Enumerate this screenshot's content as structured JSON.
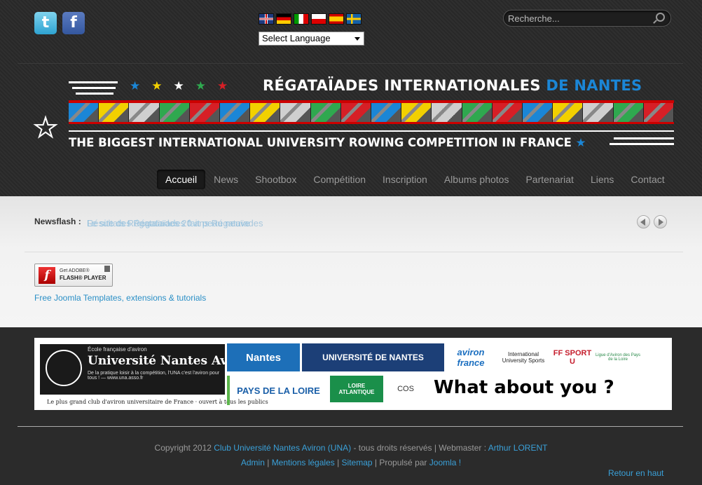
{
  "header": {
    "social": [
      {
        "name": "twitter",
        "glyph": "t"
      },
      {
        "name": "facebook",
        "glyph": "f"
      }
    ],
    "flags": [
      "en",
      "de",
      "it",
      "pl",
      "es",
      "sv"
    ],
    "language_select": "Select Language",
    "search_placeholder": "Recherche..."
  },
  "banner": {
    "title_main": "RÉGATAÏADES INTERNATIONALES",
    "title_accent": "DE NANTES",
    "subtitle": "THE BIGGEST INTERNATIONAL UNIVERSITY ROWING COMPETITION IN FRANCE",
    "star_colors": [
      "#1b86d6",
      "#f2d000",
      "#ffffff",
      "#2fa84f",
      "#d61f26"
    ],
    "strip_colors": [
      "#1b86d6",
      "#f2d000",
      "#cfcfcf",
      "#2fa84f",
      "#d61f26",
      "#1b86d6",
      "#f2d000",
      "#cfcfcf",
      "#2fa84f",
      "#d61f26",
      "#1b86d6",
      "#f2d000",
      "#cfcfcf",
      "#2fa84f",
      "#d61f26",
      "#1b86d6",
      "#f2d000",
      "#cfcfcf",
      "#2fa84f",
      "#d61f26"
    ],
    "accent_color": "#1b86d6"
  },
  "nav": {
    "items": [
      "Accueil",
      "News",
      "Shootbox",
      "Compétition",
      "Inscription",
      "Albums photos",
      "Partenariat",
      "Liens",
      "Contact"
    ],
    "active": "Accueil"
  },
  "newsflash": {
    "label": "Newsflash :",
    "text_a": "Le site des Régataïades fait peau neuve",
    "text_b": "Résultats Régataïades 20 ans Régataïades"
  },
  "content": {
    "flash_badge": {
      "line1": "Get ADOBE®",
      "line2": "FLASH® PLAYER"
    },
    "joomla_link": "Free Joomla Templates, extensions & tutorials"
  },
  "sponsors": {
    "una": {
      "small_top": "École française d'aviron",
      "name": "Université Nantes Aviron",
      "small_bottom": "De la pratique loisir à la compétition, l'UNA c'est l'aviron pour tous ! — www.una.asso.fr",
      "tagline": "Le plus grand club d'aviron universitaire de France · ouvert à tous les publics"
    },
    "logos": [
      {
        "label": "Nantes",
        "color": "#1d6fb8"
      },
      {
        "label": "UNIVERSITÉ DE NANTES",
        "color": "#1c3f77"
      },
      {
        "label": "aviron france",
        "color": "#1b6fc0"
      },
      {
        "label": "International University Sports",
        "color": "#ffffff"
      },
      {
        "label": "FF SPORT U",
        "color": "#c51c2c"
      },
      {
        "label": "Ligue d'Aviron des Pays de la Loire",
        "color": "#2a8a4a"
      },
      {
        "label": "PAYS DE LA LOIRE",
        "color": "#1a5fa8"
      },
      {
        "label": "LOIRE ATLANTIQUE",
        "color": "#1a8f4a"
      },
      {
        "label": "COS",
        "color": "#ffffff"
      }
    ],
    "what_about": "What about you ?"
  },
  "footer": {
    "copyright_pre": "Copyright 2012",
    "club_link": "Club Université Nantes Aviron (UNA)",
    "rights": "- tous droits réservés | Webmaster :",
    "webmaster": "Arthur LORENT",
    "links": [
      "Admin",
      "Mentions légales",
      "Sitemap"
    ],
    "powered": "| Propulsé par",
    "joomla": "Joomla !",
    "back_to_top": "Retour en haut"
  }
}
